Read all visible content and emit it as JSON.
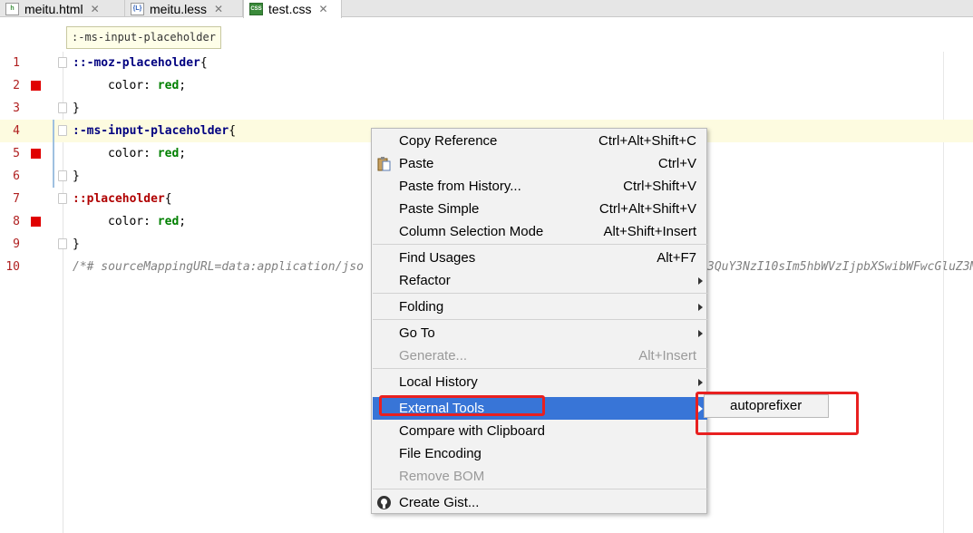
{
  "tabs": [
    {
      "name": "meitu.html",
      "icon": "html-file-icon",
      "close": "✕"
    },
    {
      "name": "meitu.less",
      "icon": "less-file-icon",
      "close": "✕"
    },
    {
      "name": "test.css",
      "icon": "css-file-icon",
      "close": "✕"
    }
  ],
  "breadcrumb": ":-ms-input-placeholder",
  "editor": {
    "line_numbers": [
      "1",
      "2",
      "3",
      "4",
      "5",
      "6",
      "7",
      "8",
      "9",
      "10"
    ],
    "lines": {
      "l1_selector": "::-moz-placeholder",
      "l1_brace": "{",
      "l2_prop": "color: ",
      "l2_val": "red",
      "l2_semi": ";",
      "l3": "}",
      "l4_selector": ":-ms-input-placeholder",
      "l4_brace": "{",
      "l5_prop": "color: ",
      "l5_val": "red",
      "l5_semi": ";",
      "l6": "}",
      "l7_selector": "::placeholder",
      "l7_brace": "{",
      "l8_prop": "color: ",
      "l8_val": "red",
      "l8_semi": ";",
      "l9": "}",
      "l10_comment_start": "/*# sourceMappingURL=data:application/jso",
      "l10_comment_end": "3QuY3NzI10sIm5hbWVzIjpbXSwibWFwcGluZ3M"
    }
  },
  "context_menu": {
    "items": [
      {
        "label": "Copy Reference",
        "shortcut": "Ctrl+Alt+Shift+C"
      },
      {
        "label": "Paste",
        "shortcut": "Ctrl+V"
      },
      {
        "label": "Paste from History...",
        "shortcut": "Ctrl+Shift+V"
      },
      {
        "label": "Paste Simple",
        "shortcut": "Ctrl+Alt+Shift+V"
      },
      {
        "label": "Column Selection Mode",
        "shortcut": "Alt+Shift+Insert"
      },
      {
        "label": "Find Usages",
        "shortcut": "Alt+F7"
      },
      {
        "label": "Refactor",
        "shortcut": ""
      },
      {
        "label": "Folding",
        "shortcut": ""
      },
      {
        "label": "Go To",
        "shortcut": ""
      },
      {
        "label": "Generate...",
        "shortcut": "Alt+Insert"
      },
      {
        "label": "Local History",
        "shortcut": ""
      },
      {
        "label": "External Tools",
        "shortcut": ""
      },
      {
        "label": "Compare with Clipboard",
        "shortcut": ""
      },
      {
        "label": "File Encoding",
        "shortcut": ""
      },
      {
        "label": "Remove BOM",
        "shortcut": ""
      },
      {
        "label": "Create Gist...",
        "shortcut": ""
      }
    ]
  },
  "submenu": {
    "items": [
      {
        "label": "autoprefixer"
      }
    ]
  },
  "colors": {
    "selection": "#3875d7",
    "annotation": "#e82020",
    "error_marker": "#e00000"
  }
}
